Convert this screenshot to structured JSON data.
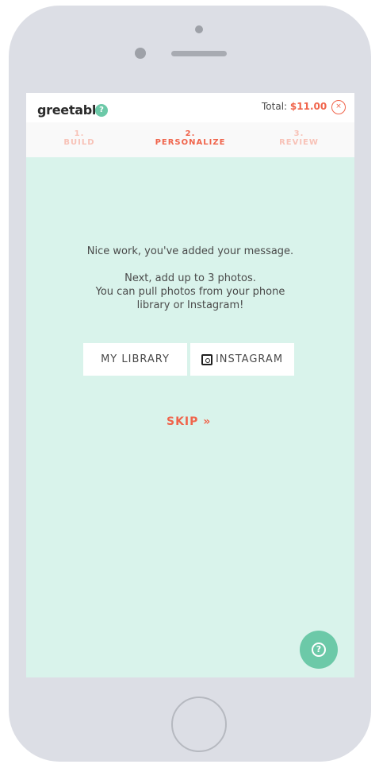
{
  "app": {
    "brand": "greetabl",
    "brand_mark": "®",
    "help_icon_glyph": "?"
  },
  "header": {
    "total_label": "Total:",
    "total_value": "$11.00",
    "close_glyph": "×"
  },
  "steps": [
    {
      "number": "1.",
      "label": "BUILD"
    },
    {
      "number": "2.",
      "label": "PERSONALIZE"
    },
    {
      "number": "3.",
      "label": "REVIEW"
    }
  ],
  "content": {
    "line1": "Nice work, you've added your message.",
    "line2": "Next, add up to 3 photos.",
    "line3": "You can pull photos from your phone library or Instagram!"
  },
  "buttons": {
    "library": "MY LIBRARY",
    "instagram": "INSTAGRAM",
    "skip": "SKIP",
    "skip_glyph": "»"
  },
  "fab": {
    "glyph": "?"
  },
  "colors": {
    "accent": "#f0644b",
    "mint_bg": "#d9f3eb",
    "green": "#6cc9a8",
    "phone": "#dcdee5"
  }
}
